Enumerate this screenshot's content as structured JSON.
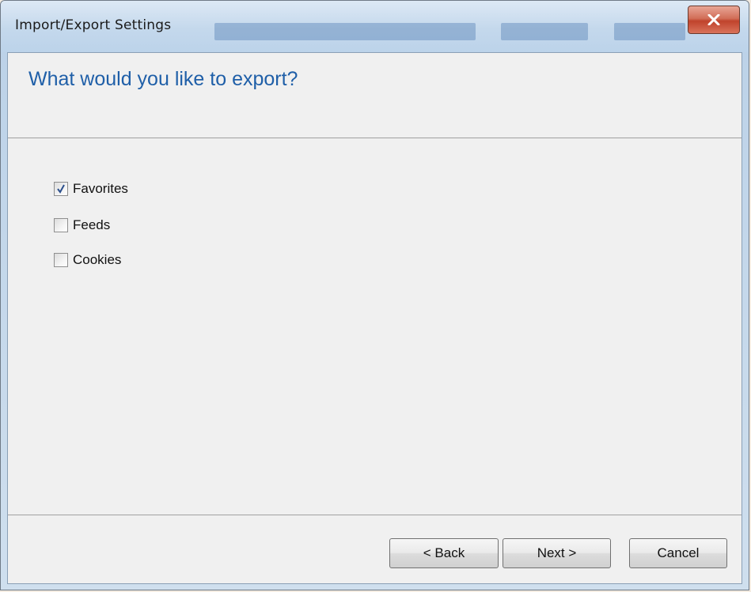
{
  "window": {
    "title": "Import/Export Settings"
  },
  "page": {
    "heading": "What would you like to export?"
  },
  "options": [
    {
      "label": "Favorites",
      "checked": true
    },
    {
      "label": "Feeds",
      "checked": false
    },
    {
      "label": "Cookies",
      "checked": false
    }
  ],
  "buttons": {
    "back": "< Back",
    "next": "Next >",
    "cancel": "Cancel"
  },
  "icons": {
    "close": "close-icon",
    "check": "checkmark-icon"
  },
  "colors": {
    "heading": "#1f5fa8",
    "close_button": "#c0432c"
  }
}
